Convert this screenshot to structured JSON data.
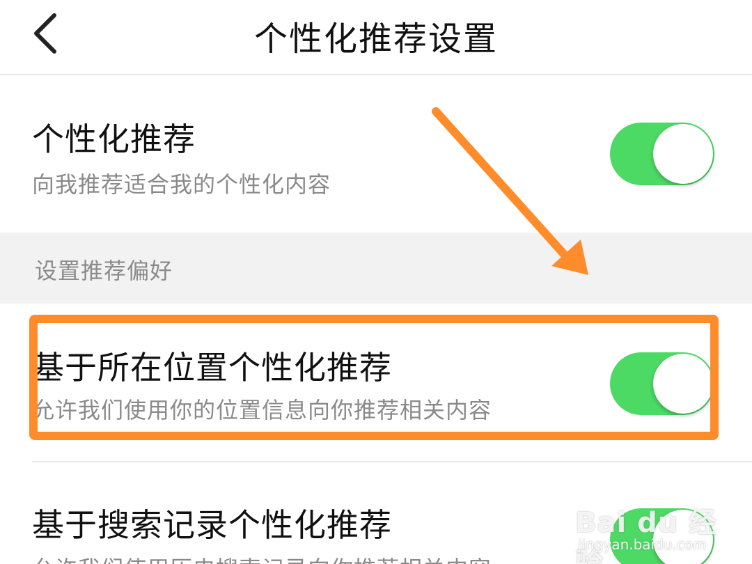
{
  "header": {
    "title": "个性化推荐设置",
    "back_icon": "chevron-left-icon"
  },
  "rows": [
    {
      "title": "个性化推荐",
      "subtitle": "向我推荐适合我的个性化内容",
      "enabled": true
    },
    {
      "title": "基于所在位置个性化推荐",
      "subtitle": "允许我们使用你的位置信息向你推荐相关内容",
      "enabled": true
    },
    {
      "title": "基于搜索记录个性化推荐",
      "subtitle": "允许我们使用历史搜索记录向你推荐相关内容",
      "enabled": true
    }
  ],
  "section": {
    "label": "设置推荐偏好"
  },
  "colors": {
    "toggle_on": "#4cd964",
    "annotation": "#ff8c2b"
  },
  "watermark": {
    "main": "Bai du 经验",
    "sub": "jingyan.baidu.com"
  }
}
